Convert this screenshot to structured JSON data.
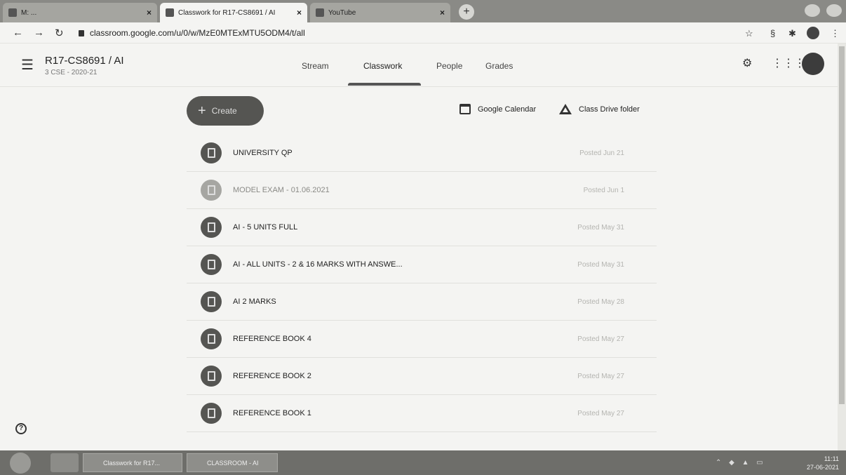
{
  "browser": {
    "tabs": [
      {
        "label": "M: ... ",
        "active": false
      },
      {
        "label": "Classwork for R17-CS8691 / AI",
        "active": true
      },
      {
        "label": "YouTube",
        "active": false
      }
    ],
    "url": "classroom.google.com/u/0/w/MzE0MTExMTU5ODM4/t/all"
  },
  "header": {
    "class_title": "R17-CS8691 / AI",
    "class_subtitle": "3 CSE - 2020-21",
    "tabs": [
      "Stream",
      "Classwork",
      "People",
      "Grades"
    ],
    "active_tab": "Classwork"
  },
  "toolbar": {
    "create_label": "Create",
    "calendar_label": "Google Calendar",
    "drive_label": "Class Drive folder"
  },
  "items": [
    {
      "title": "UNIVERSITY QP",
      "posted": "Posted Jun 21",
      "faded": false
    },
    {
      "title": "MODEL EXAM - 01.06.2021",
      "posted": "Posted Jun 1",
      "faded": true
    },
    {
      "title": "AI - 5 UNITS FULL",
      "posted": "Posted May 31",
      "faded": false
    },
    {
      "title": "AI - ALL UNITS - 2 & 16 MARKS WITH ANSWE...",
      "posted": "Posted May 31",
      "faded": false
    },
    {
      "title": "AI 2 MARKS",
      "posted": "Posted May 28",
      "faded": false
    },
    {
      "title": "REFERENCE BOOK 4",
      "posted": "Posted May 27",
      "faded": false
    },
    {
      "title": "REFERENCE BOOK 2",
      "posted": "Posted May 27",
      "faded": false
    },
    {
      "title": "REFERENCE BOOK 1",
      "posted": "Posted May 27",
      "faded": false
    }
  ],
  "taskbar": {
    "tasks": [
      "Classwork for R17...",
      "CLASSROOM - AI"
    ],
    "time": "11:11",
    "date": "27-06-2021"
  }
}
